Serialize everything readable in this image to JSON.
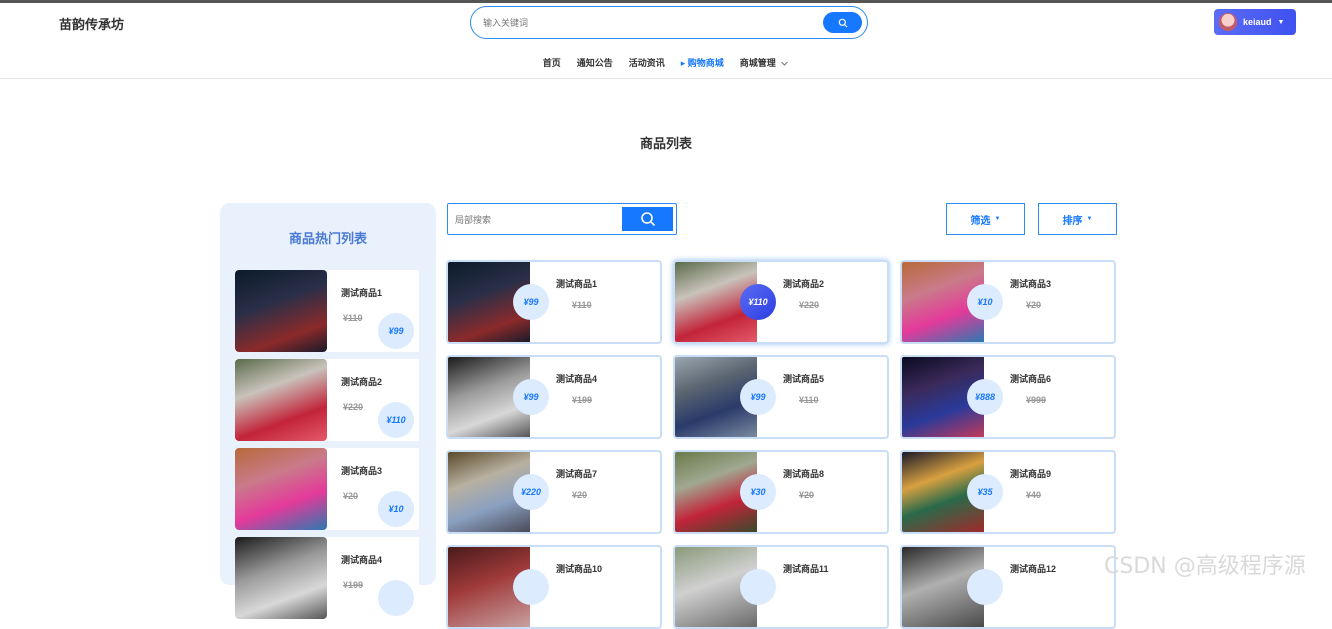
{
  "header": {
    "logo": "苗韵传承坊",
    "search_placeholder": "输入关键词",
    "user_name": "keiaud"
  },
  "nav": {
    "items": [
      {
        "label": "首页",
        "active": false
      },
      {
        "label": "通知公告",
        "active": false
      },
      {
        "label": "活动资讯",
        "active": false
      },
      {
        "label": "▸ 购物商城",
        "active": true
      },
      {
        "label": "商城管理",
        "active": false
      }
    ]
  },
  "page_title": "商品列表",
  "sidebar": {
    "title": "商品热门列表",
    "items": [
      {
        "name": "测试商品1",
        "old_price": "¥110",
        "price": "¥99"
      },
      {
        "name": "测试商品2",
        "old_price": "¥220",
        "price": "¥110"
      },
      {
        "name": "测试商品3",
        "old_price": "¥20",
        "price": "¥10"
      },
      {
        "name": "测试商品4",
        "old_price": "¥199",
        "price": ""
      }
    ]
  },
  "toolbar": {
    "local_search_placeholder": "局部搜索",
    "filter_label": "筛选",
    "sort_label": "排序"
  },
  "products": [
    {
      "name": "测试商品1",
      "price": "¥99",
      "old_price": "¥110"
    },
    {
      "name": "测试商品2",
      "price": "¥110",
      "old_price": "¥220"
    },
    {
      "name": "测试商品3",
      "price": "¥10",
      "old_price": "¥20"
    },
    {
      "name": "测试商品4",
      "price": "¥99",
      "old_price": "¥199"
    },
    {
      "name": "测试商品5",
      "price": "¥99",
      "old_price": "¥110"
    },
    {
      "name": "测试商品6",
      "price": "¥888",
      "old_price": "¥999"
    },
    {
      "name": "测试商品7",
      "price": "¥220",
      "old_price": "¥20"
    },
    {
      "name": "测试商品8",
      "price": "¥30",
      "old_price": "¥20"
    },
    {
      "name": "测试商品9",
      "price": "¥35",
      "old_price": "¥40"
    },
    {
      "name": "测试商品10",
      "price": "",
      "old_price": ""
    },
    {
      "name": "测试商品11",
      "price": "",
      "old_price": ""
    },
    {
      "name": "测试商品12",
      "price": "",
      "old_price": ""
    }
  ],
  "watermark": "CSDN @高级程序源",
  "colors": {
    "accent": "#1677ff",
    "sidebar_bg": "#e8f1fc",
    "card_border": "#c9ddf7"
  },
  "icons": [
    "search-icon",
    "caret-down-icon",
    "chevron-down-icon"
  ]
}
